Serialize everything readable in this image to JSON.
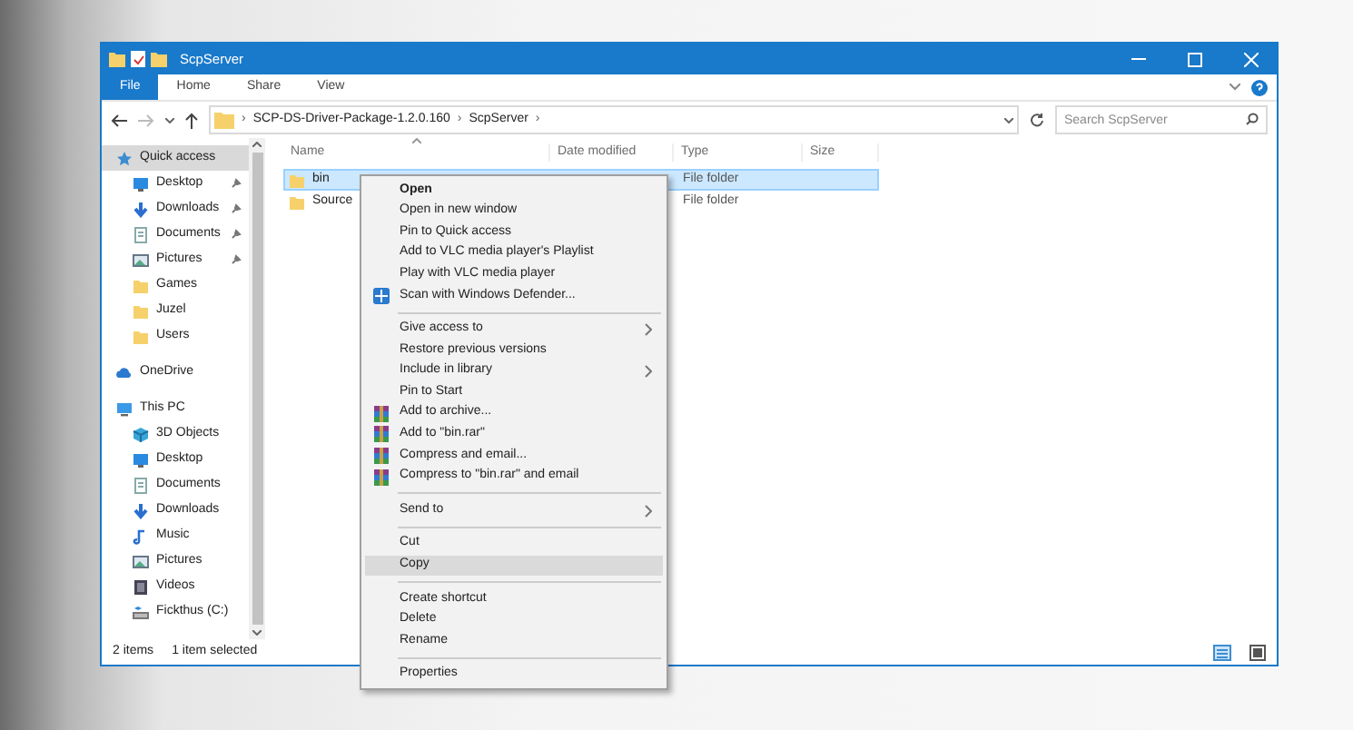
{
  "window": {
    "title": "ScpServer"
  },
  "ribbon_tabs": [
    {
      "label": "File",
      "selected": true
    },
    {
      "label": "Home",
      "selected": false
    },
    {
      "label": "Share",
      "selected": false
    },
    {
      "label": "View",
      "selected": false
    }
  ],
  "address": {
    "items": [
      {
        "kind": "separator",
        "text": "›"
      },
      {
        "kind": "segment",
        "text": "SCP-DS-Driver-Package-1.2.0.160"
      },
      {
        "kind": "separator",
        "text": "›"
      },
      {
        "kind": "segment",
        "text": "ScpServer"
      },
      {
        "kind": "separator",
        "text": "›"
      }
    ]
  },
  "search": {
    "placeholder": "Search ScpServer"
  },
  "nav": [
    {
      "label": "Quick access",
      "kind": "star",
      "selected": true,
      "children": [
        {
          "label": "Desktop",
          "kind": "desktop",
          "pinned": true,
          "selected": false
        },
        {
          "label": "Downloads",
          "kind": "download",
          "pinned": true,
          "selected": false
        },
        {
          "label": "Documents",
          "kind": "document",
          "pinned": true,
          "selected": false
        },
        {
          "label": "Pictures",
          "kind": "picture",
          "pinned": true,
          "selected": false
        },
        {
          "label": "Games",
          "kind": "folder",
          "pinned": false,
          "selected": false
        },
        {
          "label": "Juzel",
          "kind": "folder",
          "pinned": false,
          "selected": false
        },
        {
          "label": "Users",
          "kind": "folder",
          "pinned": false,
          "selected": false
        }
      ]
    },
    {
      "label": "OneDrive",
      "kind": "cloud",
      "selected": false
    },
    {
      "label": "This PC",
      "kind": "pc",
      "selected": false,
      "children": [
        {
          "label": "3D Objects",
          "kind": "cube",
          "pinned": false,
          "selected": false
        },
        {
          "label": "Desktop",
          "kind": "desktop",
          "pinned": false,
          "selected": false
        },
        {
          "label": "Documents",
          "kind": "document",
          "pinned": false,
          "selected": false
        },
        {
          "label": "Downloads",
          "kind": "download",
          "pinned": false,
          "selected": false
        },
        {
          "label": "Music",
          "kind": "music",
          "pinned": false,
          "selected": false
        },
        {
          "label": "Pictures",
          "kind": "picture",
          "pinned": false,
          "selected": false
        },
        {
          "label": "Videos",
          "kind": "video",
          "pinned": false,
          "selected": false
        },
        {
          "label": "Fickthus (C:)",
          "kind": "drive",
          "pinned": false,
          "selected": false
        }
      ]
    }
  ],
  "table": {
    "columns": [
      "Name",
      "Date modified",
      "Type",
      "Size"
    ],
    "rows": [
      {
        "name": "bin",
        "type": "File folder",
        "selected": true
      },
      {
        "name": "Source",
        "type": "File folder",
        "selected": false
      }
    ]
  },
  "status_bar": {
    "count": "2 items",
    "selection": "1 item selected"
  },
  "context_menu": [
    {
      "kind": "item",
      "label": "Open",
      "bold": true,
      "submenu": false,
      "selected": false
    },
    {
      "kind": "item",
      "label": "Open in new window",
      "bold": false,
      "submenu": false,
      "selected": false
    },
    {
      "kind": "item",
      "label": "Pin to Quick access",
      "bold": false,
      "submenu": false,
      "selected": false
    },
    {
      "kind": "item",
      "label": "Add to VLC media player's Playlist",
      "bold": false,
      "submenu": false,
      "selected": false
    },
    {
      "kind": "item",
      "label": "Play with VLC media player",
      "bold": false,
      "submenu": false,
      "selected": false
    },
    {
      "kind": "defender",
      "label": "Scan with Windows Defender...",
      "bold": false,
      "submenu": false,
      "selected": false
    },
    {
      "kind": "separator"
    },
    {
      "kind": "item",
      "label": "Give access to",
      "bold": false,
      "submenu": true,
      "selected": false
    },
    {
      "kind": "item",
      "label": "Restore previous versions",
      "bold": false,
      "submenu": false,
      "selected": false
    },
    {
      "kind": "item",
      "label": "Include in library",
      "bold": false,
      "submenu": true,
      "selected": false
    },
    {
      "kind": "item",
      "label": "Pin to Start",
      "bold": false,
      "submenu": false,
      "selected": false
    },
    {
      "kind": "archive",
      "label": "Add to archive...",
      "bold": false,
      "submenu": false,
      "selected": false
    },
    {
      "kind": "archive",
      "label": "Add to \"bin.rar\"",
      "bold": false,
      "submenu": false,
      "selected": false
    },
    {
      "kind": "archive",
      "label": "Compress and email...",
      "bold": false,
      "submenu": false,
      "selected": false
    },
    {
      "kind": "archive",
      "label": "Compress to \"bin.rar\" and email",
      "bold": false,
      "submenu": false,
      "selected": false
    },
    {
      "kind": "separator"
    },
    {
      "kind": "item",
      "label": "Send to",
      "bold": false,
      "submenu": true,
      "selected": false
    },
    {
      "kind": "separator"
    },
    {
      "kind": "item",
      "label": "Cut",
      "bold": false,
      "submenu": false,
      "selected": false
    },
    {
      "kind": "item",
      "label": "Copy",
      "bold": false,
      "submenu": false,
      "selected": true
    },
    {
      "kind": "separator"
    },
    {
      "kind": "item",
      "label": "Create shortcut",
      "bold": false,
      "submenu": false,
      "selected": false
    },
    {
      "kind": "item",
      "label": "Delete",
      "bold": false,
      "submenu": false,
      "selected": false
    },
    {
      "kind": "item",
      "label": "Rename",
      "bold": false,
      "submenu": false,
      "selected": false
    },
    {
      "kind": "separator"
    },
    {
      "kind": "item",
      "label": "Properties",
      "bold": false,
      "submenu": false,
      "selected": false
    }
  ]
}
